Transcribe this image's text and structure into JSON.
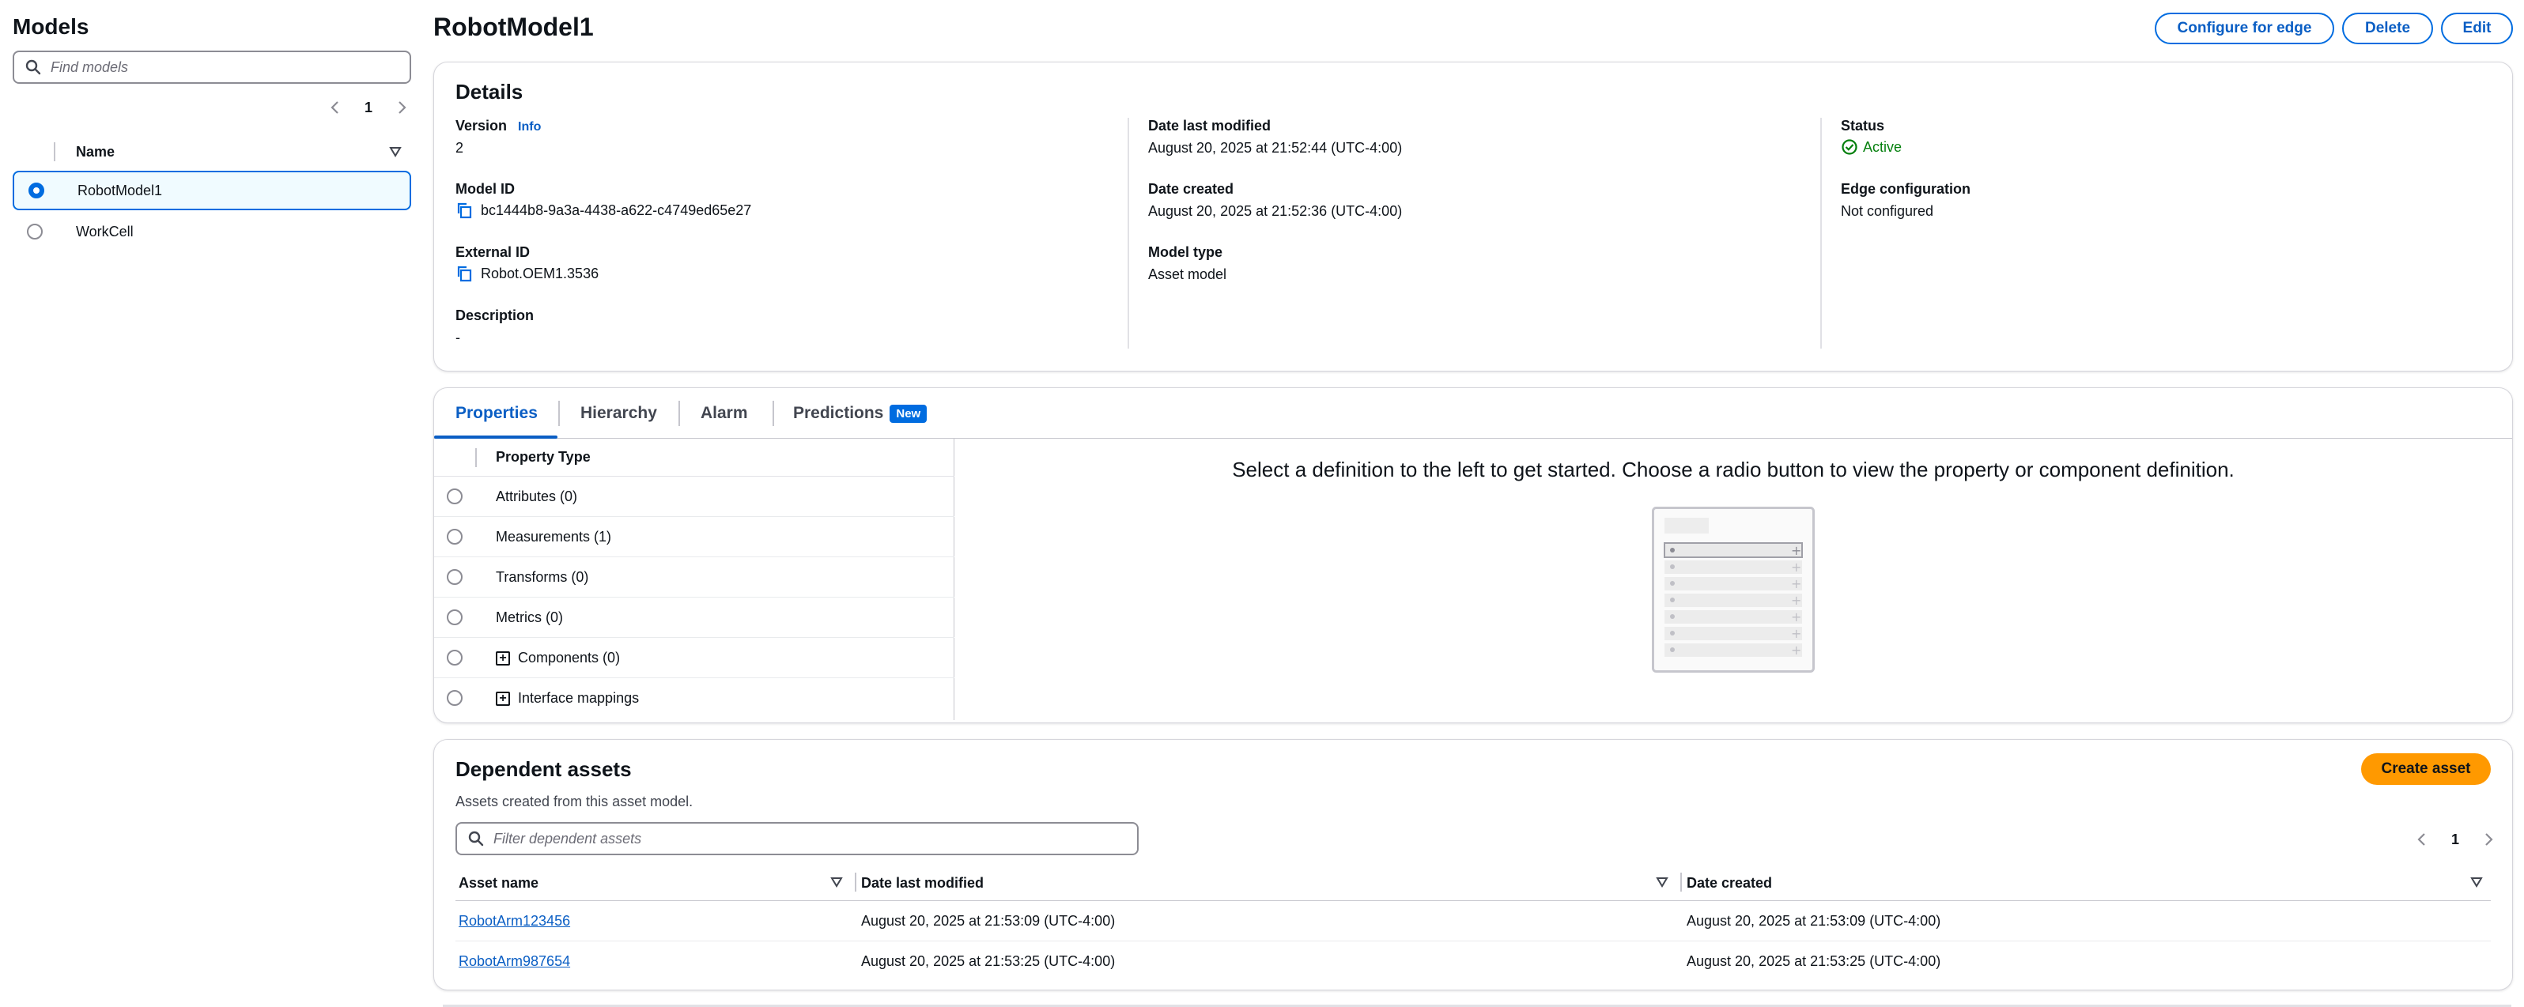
{
  "sidebar": {
    "title": "Models",
    "search_placeholder": "Find models",
    "page": "1",
    "column_name": "Name",
    "items": [
      {
        "label": "RobotModel1",
        "selected": true
      },
      {
        "label": "WorkCell",
        "selected": false
      }
    ]
  },
  "header": {
    "title": "RobotModel1",
    "buttons": {
      "configure_edge": "Configure for edge",
      "delete": "Delete",
      "edit": "Edit"
    }
  },
  "details": {
    "title": "Details",
    "version_label": "Version",
    "info_link": "Info",
    "version_value": "2",
    "model_id_label": "Model ID",
    "model_id_value": "bc1444b8-9a3a-4438-a622-c4749ed65e27",
    "external_id_label": "External ID",
    "external_id_value": "Robot.OEM1.3536",
    "description_label": "Description",
    "description_value": "-",
    "date_modified_label": "Date last modified",
    "date_modified_value": "August 20, 2025 at 21:52:44 (UTC-4:00)",
    "date_created_label": "Date created",
    "date_created_value": "August 20, 2025 at 21:52:36 (UTC-4:00)",
    "model_type_label": "Model type",
    "model_type_value": "Asset model",
    "status_label": "Status",
    "status_value": "Active",
    "edge_label": "Edge configuration",
    "edge_value": "Not configured"
  },
  "tabs": [
    {
      "label": "Properties"
    },
    {
      "label": "Hierarchy"
    },
    {
      "label": "Alarm"
    },
    {
      "label": "Predictions",
      "badge": "New"
    }
  ],
  "properties": {
    "column_header": "Property Type",
    "rows": [
      {
        "label": "Attributes (0)"
      },
      {
        "label": "Measurements (1)"
      },
      {
        "label": "Transforms (0)"
      },
      {
        "label": "Metrics (0)"
      },
      {
        "label": "Components (0)"
      },
      {
        "label": "Interface mappings"
      }
    ],
    "empty_message": "Select a definition to the left to get started. Choose a radio button to view the property or component definition."
  },
  "dependent_assets": {
    "title": "Dependent assets",
    "subtitle": "Assets created from this asset model.",
    "create_button": "Create asset",
    "filter_placeholder": "Filter dependent assets",
    "page": "1",
    "columns": [
      "Asset name",
      "Date last modified",
      "Date created"
    ],
    "rows": [
      {
        "name": "RobotArm123456",
        "modified": "August 20, 2025 at 21:53:09 (UTC-4:00)",
        "created": "August 20, 2025 at 21:53:09 (UTC-4:00)"
      },
      {
        "name": "RobotArm987654",
        "modified": "August 20, 2025 at 21:53:25 (UTC-4:00)",
        "created": "August 20, 2025 at 21:53:25 (UTC-4:00)"
      }
    ]
  },
  "colors": {
    "accent": "#006ce0",
    "link": "#0a5ec4",
    "success": "#037f0c",
    "primary_button": "#ff9900"
  }
}
